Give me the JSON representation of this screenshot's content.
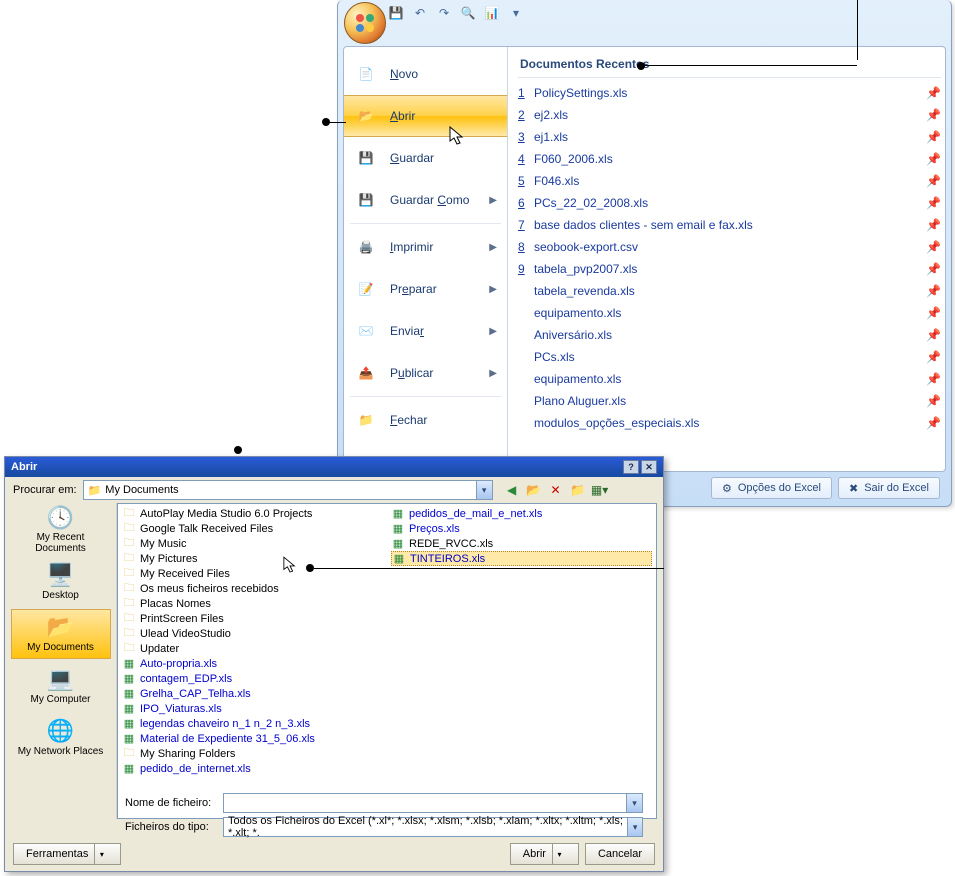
{
  "office_menu": {
    "recents_title": "Documentos Recentes",
    "items": [
      {
        "label_html": "<u>N</u>ovo"
      },
      {
        "label_html": "<u>A</u>brir"
      },
      {
        "label_html": "<u>G</u>uardar"
      },
      {
        "label_html": "Guardar <u>C</u>omo",
        "submenu": true
      },
      {
        "label_html": "<u>I</u>mprimir",
        "submenu": true
      },
      {
        "label_html": "Pr<u>e</u>parar",
        "submenu": true
      },
      {
        "label_html": "Envia<u>r</u>",
        "submenu": true
      },
      {
        "label_html": "P<u>u</u>blicar",
        "submenu": true
      },
      {
        "label_html": "<u>F</u>echar"
      }
    ],
    "recents": [
      {
        "num": "1",
        "name": "PolicySettings.xls"
      },
      {
        "num": "2",
        "name": "ej2.xls"
      },
      {
        "num": "3",
        "name": "ej1.xls"
      },
      {
        "num": "4",
        "name": "F060_2006.xls"
      },
      {
        "num": "5",
        "name": "F046.xls"
      },
      {
        "num": "6",
        "name": "PCs_22_02_2008.xls"
      },
      {
        "num": "7",
        "name": "base dados clientes - sem email e fax.xls"
      },
      {
        "num": "8",
        "name": "seobook-export.csv"
      },
      {
        "num": "9",
        "name": "tabela_pvp2007.xls"
      },
      {
        "num": "",
        "name": "tabela_revenda.xls"
      },
      {
        "num": "",
        "name": "equipamento.xls"
      },
      {
        "num": "",
        "name": "Aniversário.xls"
      },
      {
        "num": "",
        "name": "PCs.xls"
      },
      {
        "num": "",
        "name": "equipamento.xls"
      },
      {
        "num": "",
        "name": "Plano Aluguer.xls"
      },
      {
        "num": "",
        "name": "modulos_opções_especiais.xls"
      }
    ],
    "footer": {
      "options": "Opções do Excel",
      "exit": "Sair do Excel"
    }
  },
  "open_dialog": {
    "title": "Abrir",
    "look_in_label": "Procurar em:",
    "look_in_value": "My Documents",
    "places": [
      {
        "label": "My Recent Documents"
      },
      {
        "label": "Desktop"
      },
      {
        "label": "My Documents"
      },
      {
        "label": "My Computer"
      },
      {
        "label": "My Network Places"
      }
    ],
    "col1": [
      {
        "t": "folder",
        "name": "AutoPlay Media Studio 6.0 Projects"
      },
      {
        "t": "folder",
        "name": "Google Talk Received Files"
      },
      {
        "t": "folder",
        "name": "My Music"
      },
      {
        "t": "folder",
        "name": "My Pictures"
      },
      {
        "t": "folder",
        "name": "My Received Files"
      },
      {
        "t": "folder",
        "name": "Os meus ficheiros recebidos"
      },
      {
        "t": "folder",
        "name": "Placas Nomes"
      },
      {
        "t": "folder",
        "name": "PrintScreen Files"
      },
      {
        "t": "folder",
        "name": "Ulead VideoStudio"
      },
      {
        "t": "folder",
        "name": "Updater"
      },
      {
        "t": "xls",
        "name": "Auto-propria.xls",
        "link": true
      },
      {
        "t": "xls",
        "name": "contagem_EDP.xls",
        "link": true
      },
      {
        "t": "xls",
        "name": "Grelha_CAP_Telha.xls",
        "link": true
      },
      {
        "t": "xls",
        "name": "IPO_Viaturas.xls",
        "link": true
      },
      {
        "t": "xls",
        "name": "legendas chaveiro n_1 n_2 n_3.xls",
        "link": true
      },
      {
        "t": "xls",
        "name": "Material de Expediente 31_5_06.xls",
        "link": true
      },
      {
        "t": "folder",
        "name": "My Sharing Folders"
      },
      {
        "t": "xls",
        "name": "pedido_de_internet.xls",
        "link": true
      }
    ],
    "col2": [
      {
        "t": "xls",
        "name": "pedidos_de_mail_e_net.xls",
        "link": true
      },
      {
        "t": "xls",
        "name": "Preços.xls",
        "link": true
      },
      {
        "t": "xls",
        "name": "REDE_RVCC.xls"
      },
      {
        "t": "xls",
        "name": "TINTEIROS.xls",
        "link": true,
        "sel": true
      }
    ],
    "filename_label": "Nome de ficheiro:",
    "filename_value": "",
    "filetype_label": "Ficheiros do tipo:",
    "filetype_value": "Todos os Ficheiros do Excel (*.xl*; *.xlsx; *.xlsm; *.xlsb; *.xlam; *.xltx; *.xltm; *.xls; *.xlt; *.",
    "tools_btn": "Ferramentas",
    "open_btn": "Abrir",
    "cancel_btn": "Cancelar"
  }
}
